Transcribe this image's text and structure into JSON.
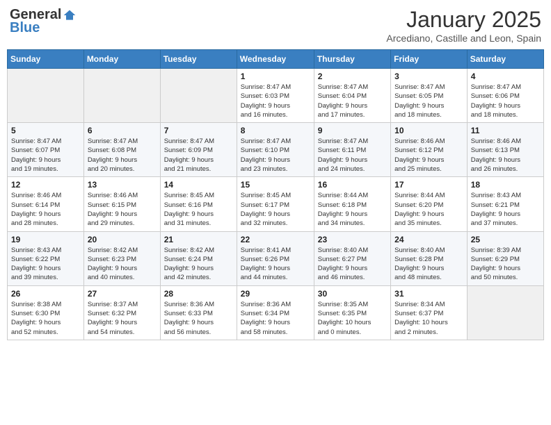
{
  "header": {
    "logo_general": "General",
    "logo_blue": "Blue",
    "month": "January 2025",
    "location": "Arcediano, Castille and Leon, Spain"
  },
  "weekdays": [
    "Sunday",
    "Monday",
    "Tuesday",
    "Wednesday",
    "Thursday",
    "Friday",
    "Saturday"
  ],
  "weeks": [
    [
      {
        "day": "",
        "info": ""
      },
      {
        "day": "",
        "info": ""
      },
      {
        "day": "",
        "info": ""
      },
      {
        "day": "1",
        "info": "Sunrise: 8:47 AM\nSunset: 6:03 PM\nDaylight: 9 hours\nand 16 minutes."
      },
      {
        "day": "2",
        "info": "Sunrise: 8:47 AM\nSunset: 6:04 PM\nDaylight: 9 hours\nand 17 minutes."
      },
      {
        "day": "3",
        "info": "Sunrise: 8:47 AM\nSunset: 6:05 PM\nDaylight: 9 hours\nand 18 minutes."
      },
      {
        "day": "4",
        "info": "Sunrise: 8:47 AM\nSunset: 6:06 PM\nDaylight: 9 hours\nand 18 minutes."
      }
    ],
    [
      {
        "day": "5",
        "info": "Sunrise: 8:47 AM\nSunset: 6:07 PM\nDaylight: 9 hours\nand 19 minutes."
      },
      {
        "day": "6",
        "info": "Sunrise: 8:47 AM\nSunset: 6:08 PM\nDaylight: 9 hours\nand 20 minutes."
      },
      {
        "day": "7",
        "info": "Sunrise: 8:47 AM\nSunset: 6:09 PM\nDaylight: 9 hours\nand 21 minutes."
      },
      {
        "day": "8",
        "info": "Sunrise: 8:47 AM\nSunset: 6:10 PM\nDaylight: 9 hours\nand 23 minutes."
      },
      {
        "day": "9",
        "info": "Sunrise: 8:47 AM\nSunset: 6:11 PM\nDaylight: 9 hours\nand 24 minutes."
      },
      {
        "day": "10",
        "info": "Sunrise: 8:46 AM\nSunset: 6:12 PM\nDaylight: 9 hours\nand 25 minutes."
      },
      {
        "day": "11",
        "info": "Sunrise: 8:46 AM\nSunset: 6:13 PM\nDaylight: 9 hours\nand 26 minutes."
      }
    ],
    [
      {
        "day": "12",
        "info": "Sunrise: 8:46 AM\nSunset: 6:14 PM\nDaylight: 9 hours\nand 28 minutes."
      },
      {
        "day": "13",
        "info": "Sunrise: 8:46 AM\nSunset: 6:15 PM\nDaylight: 9 hours\nand 29 minutes."
      },
      {
        "day": "14",
        "info": "Sunrise: 8:45 AM\nSunset: 6:16 PM\nDaylight: 9 hours\nand 31 minutes."
      },
      {
        "day": "15",
        "info": "Sunrise: 8:45 AM\nSunset: 6:17 PM\nDaylight: 9 hours\nand 32 minutes."
      },
      {
        "day": "16",
        "info": "Sunrise: 8:44 AM\nSunset: 6:18 PM\nDaylight: 9 hours\nand 34 minutes."
      },
      {
        "day": "17",
        "info": "Sunrise: 8:44 AM\nSunset: 6:20 PM\nDaylight: 9 hours\nand 35 minutes."
      },
      {
        "day": "18",
        "info": "Sunrise: 8:43 AM\nSunset: 6:21 PM\nDaylight: 9 hours\nand 37 minutes."
      }
    ],
    [
      {
        "day": "19",
        "info": "Sunrise: 8:43 AM\nSunset: 6:22 PM\nDaylight: 9 hours\nand 39 minutes."
      },
      {
        "day": "20",
        "info": "Sunrise: 8:42 AM\nSunset: 6:23 PM\nDaylight: 9 hours\nand 40 minutes."
      },
      {
        "day": "21",
        "info": "Sunrise: 8:42 AM\nSunset: 6:24 PM\nDaylight: 9 hours\nand 42 minutes."
      },
      {
        "day": "22",
        "info": "Sunrise: 8:41 AM\nSunset: 6:26 PM\nDaylight: 9 hours\nand 44 minutes."
      },
      {
        "day": "23",
        "info": "Sunrise: 8:40 AM\nSunset: 6:27 PM\nDaylight: 9 hours\nand 46 minutes."
      },
      {
        "day": "24",
        "info": "Sunrise: 8:40 AM\nSunset: 6:28 PM\nDaylight: 9 hours\nand 48 minutes."
      },
      {
        "day": "25",
        "info": "Sunrise: 8:39 AM\nSunset: 6:29 PM\nDaylight: 9 hours\nand 50 minutes."
      }
    ],
    [
      {
        "day": "26",
        "info": "Sunrise: 8:38 AM\nSunset: 6:30 PM\nDaylight: 9 hours\nand 52 minutes."
      },
      {
        "day": "27",
        "info": "Sunrise: 8:37 AM\nSunset: 6:32 PM\nDaylight: 9 hours\nand 54 minutes."
      },
      {
        "day": "28",
        "info": "Sunrise: 8:36 AM\nSunset: 6:33 PM\nDaylight: 9 hours\nand 56 minutes."
      },
      {
        "day": "29",
        "info": "Sunrise: 8:36 AM\nSunset: 6:34 PM\nDaylight: 9 hours\nand 58 minutes."
      },
      {
        "day": "30",
        "info": "Sunrise: 8:35 AM\nSunset: 6:35 PM\nDaylight: 10 hours\nand 0 minutes."
      },
      {
        "day": "31",
        "info": "Sunrise: 8:34 AM\nSunset: 6:37 PM\nDaylight: 10 hours\nand 2 minutes."
      },
      {
        "day": "",
        "info": ""
      }
    ]
  ]
}
